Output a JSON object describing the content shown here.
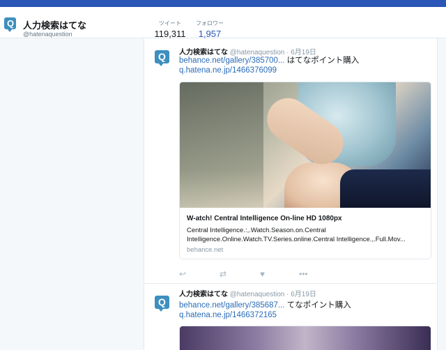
{
  "profile": {
    "name": "人力検索はてな",
    "handle": "@hatenaquestion",
    "logo_letter": "Q"
  },
  "stats": {
    "tweets_label": "ツイート",
    "tweets_value": "119,311",
    "followers_label": "フォロワー",
    "followers_value": "1,957"
  },
  "tweets": [
    {
      "name": "人力検索はてな",
      "handle": "@hatenaquestion",
      "separator": "·",
      "date": "6月19日",
      "link1": "behance.net/gallery/385700...",
      "text1": " はてなポイント購入",
      "link2": "q.hatena.ne.jp/1466376099",
      "card": {
        "title": "W-atch! Central Intelligence On-line HD 1080px",
        "description": "Central Intelligence.:,.Watch.Season.on.Central Intelligence.Online.Watch.TV.Series.online.Central Intelligence.,.Full.Mov...",
        "domain": "behance.net"
      }
    },
    {
      "name": "人力検索はてな",
      "handle": "@hatenaquestion",
      "separator": "·",
      "date": "6月19日",
      "link1": "behance.net/gallery/385687...",
      "text1": " てなポイント購入",
      "link2": "q.hatena.ne.jp/1466372165"
    }
  ],
  "actions": {
    "reply_icon": "↩",
    "retweet_icon": "⇄",
    "like_icon": "♥",
    "more_icon": "•••"
  },
  "colors": {
    "accent": "#2a56b8",
    "link": "#2a6cb8",
    "logo": "#3d8fbf"
  }
}
